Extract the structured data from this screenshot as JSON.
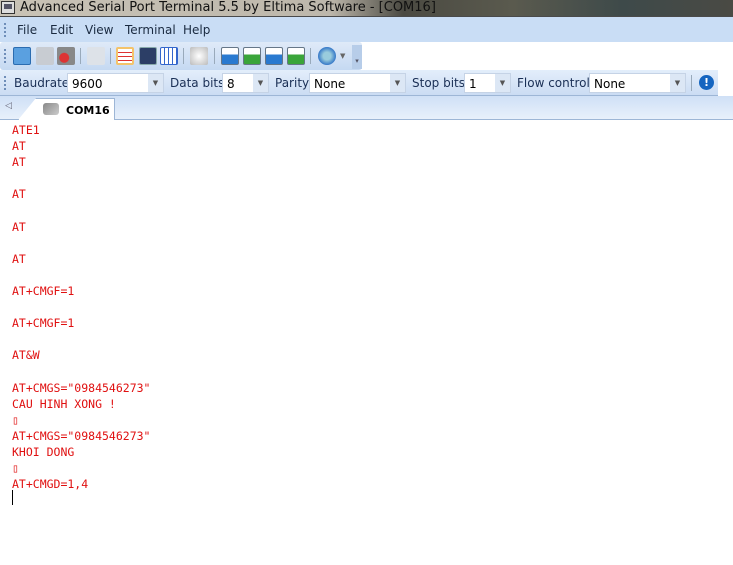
{
  "window": {
    "title": "Advanced Serial Port Terminal 5.5 by Eltima Software - [COM16]"
  },
  "menu": [
    "File",
    "Edit",
    "View",
    "Terminal",
    "Help"
  ],
  "toolbar": {
    "icons": [
      "new-session-icon",
      "connect-icon",
      "disconnect-icon",
      "copy-icon",
      "text-view-icon",
      "vt100-view-icon",
      "hex-view-icon",
      "clear-icon",
      "send-file-icon",
      "receive-file-icon",
      "send-binary-icon",
      "receive-binary-icon",
      "help-icon"
    ]
  },
  "config": {
    "baudrate_label": "Baudrate",
    "baudrate": "9600",
    "databits_label": "Data bits",
    "databits": "8",
    "parity_label": "Parity",
    "parity": "None",
    "stopbits_label": "Stop bits",
    "stopbits": "1",
    "flow_label": "Flow control",
    "flow": "None"
  },
  "tab": {
    "label": "COM16"
  },
  "terminal": {
    "lines": [
      "ATE1",
      "AT",
      "AT",
      "",
      "AT",
      "",
      "AT",
      "",
      "AT",
      "",
      "AT+CMGF=1",
      "",
      "AT+CMGF=1",
      "",
      "AT&W",
      "",
      "AT+CMGS=\"0984546273\"",
      "CAU HINH XONG !",
      "▯",
      "AT+CMGS=\"0984546273\"",
      "KHOI DONG",
      "▯",
      "AT+CMGD=1,4"
    ]
  }
}
